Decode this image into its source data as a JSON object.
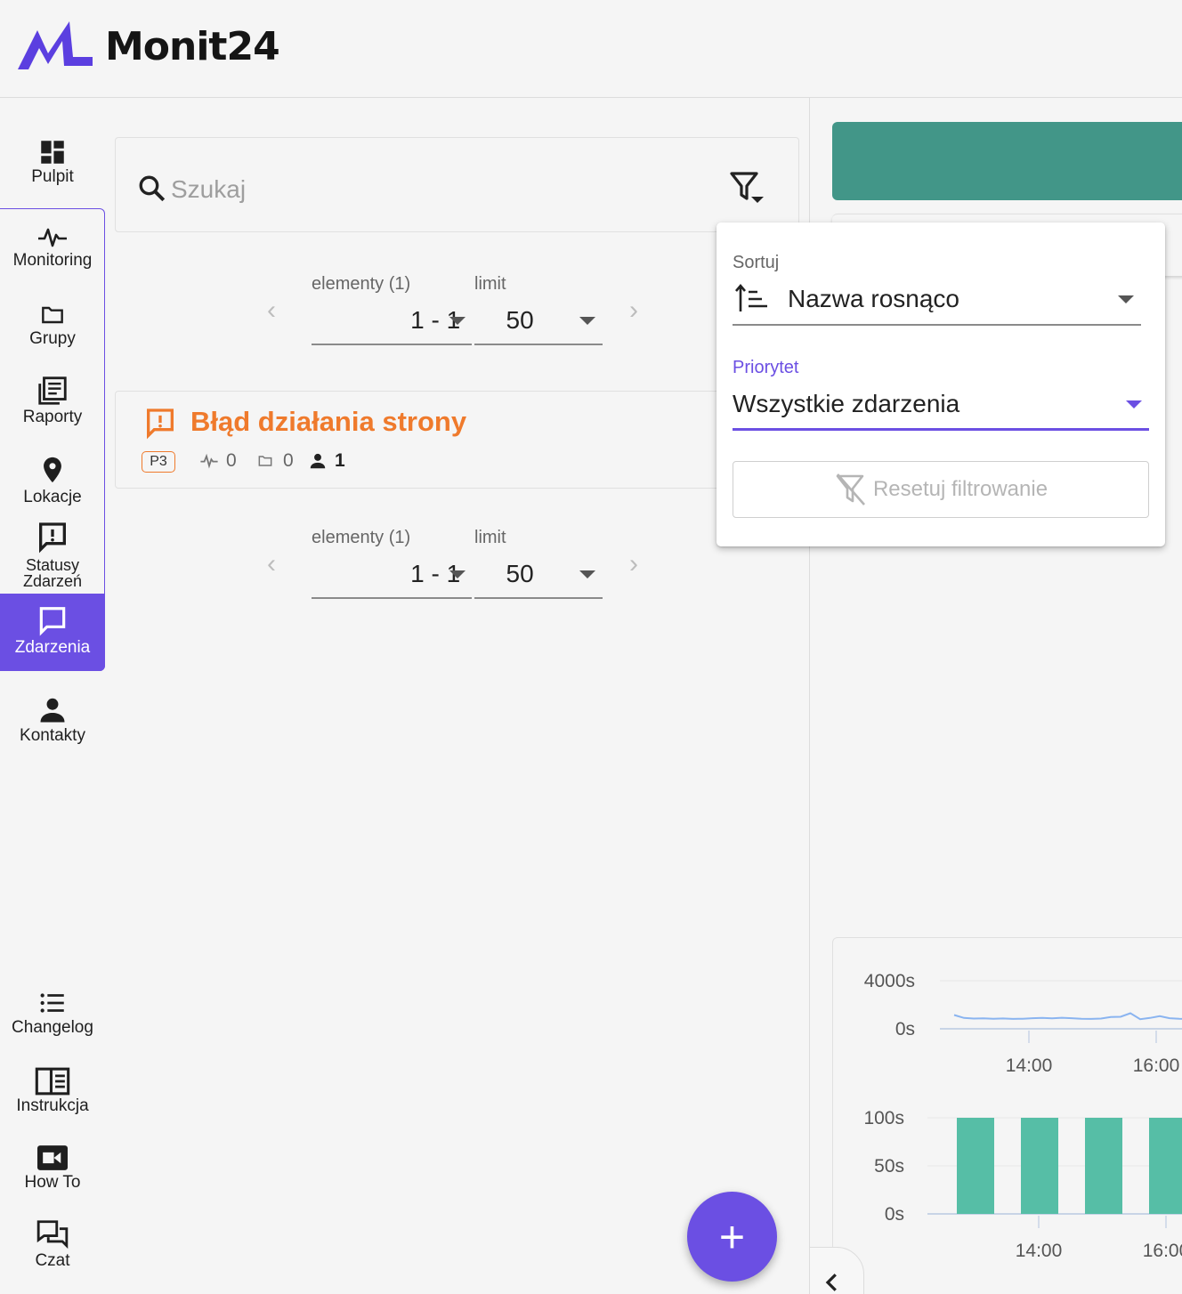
{
  "app": {
    "name": "Monit24"
  },
  "colors": {
    "primary": "#6b4fe3",
    "accent_orange": "#ef7a2c",
    "green": "#429688",
    "bar": "#56bea6",
    "line": "#8ab4f0"
  },
  "sidebar": {
    "items": [
      {
        "key": "pulpit",
        "label": "Pulpit",
        "icon": "dashboard-icon"
      },
      {
        "key": "monitoring",
        "label": "Monitoring",
        "icon": "pulse-icon"
      },
      {
        "key": "grupy",
        "label": "Grupy",
        "icon": "folder-icon"
      },
      {
        "key": "raporty",
        "label": "Raporty",
        "icon": "reports-icon"
      },
      {
        "key": "lokacje",
        "label": "Lokacje",
        "icon": "location-pin-icon"
      },
      {
        "key": "statusy",
        "label": "Statusy Zdarzeń",
        "icon": "alert-message-icon"
      },
      {
        "key": "zdarzenia",
        "label": "Zdarzenia",
        "icon": "chat-bubble-icon",
        "active": true
      },
      {
        "key": "kontakty",
        "label": "Kontakty",
        "icon": "person-icon"
      },
      {
        "key": "changelog",
        "label": "Changelog",
        "icon": "list-icon"
      },
      {
        "key": "instrukcja",
        "label": "Instrukcja",
        "icon": "book-icon"
      },
      {
        "key": "howto",
        "label": "How To",
        "icon": "video-icon"
      },
      {
        "key": "czat",
        "label": "Czat",
        "icon": "forum-icon"
      }
    ]
  },
  "search": {
    "placeholder": "Szukaj"
  },
  "pager": {
    "elements_label": "elementy (1)",
    "range_value": "1 - 1",
    "limit_label": "limit",
    "limit_value": "50"
  },
  "event": {
    "title": "Błąd działania strony",
    "priority": "P3",
    "monitors": "0",
    "groups": "0",
    "contacts": "1"
  },
  "filter_panel": {
    "sort_label": "Sortuj",
    "sort_value": "Nazwa rosnąco",
    "priority_label": "Priorytet",
    "priority_value": "Wszystkie zdarzenia",
    "reset_label": "Resetuj filtrowanie"
  },
  "fab": {
    "label": "+"
  },
  "chart_data": [
    {
      "type": "line",
      "y_ticks": [
        "4000s",
        "0s"
      ],
      "x_ticks": [
        "14:00",
        "16:00"
      ],
      "ylim": [
        0,
        4000
      ],
      "series": [
        {
          "values": [
            1150,
            900,
            850,
            870,
            840,
            860,
            820,
            840,
            880,
            900,
            870,
            920,
            880,
            830,
            820,
            850,
            980,
            1000,
            1300,
            800,
            900,
            1050,
            880,
            830,
            820
          ]
        }
      ]
    },
    {
      "type": "bar",
      "y_ticks": [
        "100s",
        "50s",
        "0s"
      ],
      "x_ticks": [
        "14:00",
        "16:00"
      ],
      "ylim": [
        0,
        100
      ],
      "values": [
        100,
        100,
        100,
        100
      ]
    }
  ]
}
